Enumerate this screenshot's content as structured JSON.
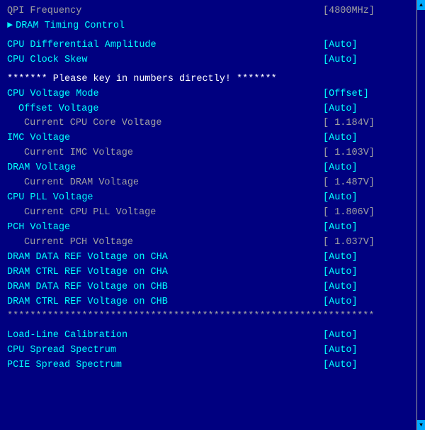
{
  "rows": [
    {
      "id": "qpi-freq",
      "label": "QPI Frequency",
      "value": "[4800MHz]",
      "labelClass": "gray",
      "valueClass": "gray",
      "indent": 0,
      "type": "normal"
    },
    {
      "id": "dram-timing",
      "label": "DRAM Timing Control",
      "value": "",
      "labelClass": "cyan",
      "valueClass": "",
      "indent": 0,
      "type": "arrow"
    },
    {
      "id": "spacer1",
      "label": "",
      "value": "",
      "type": "spacer"
    },
    {
      "id": "cpu-diff-amp",
      "label": "CPU Differential Amplitude",
      "value": "[Auto]",
      "labelClass": "cyan",
      "valueClass": "cyan",
      "indent": 0,
      "type": "normal"
    },
    {
      "id": "cpu-clk-skew",
      "label": "CPU Clock Skew",
      "value": "[Auto]",
      "labelClass": "cyan",
      "valueClass": "cyan",
      "indent": 0,
      "type": "normal"
    },
    {
      "id": "spacer2",
      "label": "",
      "value": "",
      "type": "spacer"
    },
    {
      "id": "warning",
      "label": "******* Please key in numbers directly! *******",
      "value": "",
      "labelClass": "white",
      "valueClass": "",
      "indent": 0,
      "type": "full"
    },
    {
      "id": "cpu-volt-mode",
      "label": "CPU Voltage Mode",
      "value": "[Offset]",
      "labelClass": "cyan",
      "valueClass": "cyan",
      "indent": 0,
      "type": "normal"
    },
    {
      "id": "offset-volt",
      "label": "Offset Voltage",
      "value": "[Auto]",
      "labelClass": "cyan",
      "valueClass": "cyan",
      "indent": 1,
      "type": "normal"
    },
    {
      "id": "curr-cpu-core",
      "label": "Current CPU Core Voltage",
      "value": "[ 1.184V]",
      "labelClass": "gray",
      "valueClass": "gray",
      "indent": 2,
      "type": "normal"
    },
    {
      "id": "imc-volt",
      "label": "IMC Voltage",
      "value": "[Auto]",
      "labelClass": "cyan",
      "valueClass": "cyan",
      "indent": 0,
      "type": "normal"
    },
    {
      "id": "curr-imc",
      "label": "Current IMC Voltage",
      "value": "[ 1.103V]",
      "labelClass": "gray",
      "valueClass": "gray",
      "indent": 2,
      "type": "normal"
    },
    {
      "id": "dram-volt",
      "label": "DRAM Voltage",
      "value": "[Auto]",
      "labelClass": "cyan",
      "valueClass": "cyan",
      "indent": 0,
      "type": "normal"
    },
    {
      "id": "curr-dram",
      "label": "Current DRAM Voltage",
      "value": "[ 1.487V]",
      "labelClass": "gray",
      "valueClass": "gray",
      "indent": 2,
      "type": "normal"
    },
    {
      "id": "cpu-pll-volt",
      "label": "CPU PLL Voltage",
      "value": "[Auto]",
      "labelClass": "cyan",
      "valueClass": "cyan",
      "indent": 0,
      "type": "normal"
    },
    {
      "id": "curr-cpu-pll",
      "label": "Current CPU PLL Voltage",
      "value": "[ 1.806V]",
      "labelClass": "gray",
      "valueClass": "gray",
      "indent": 2,
      "type": "normal"
    },
    {
      "id": "pch-volt",
      "label": "PCH Voltage",
      "value": "[Auto]",
      "labelClass": "cyan",
      "valueClass": "cyan",
      "indent": 0,
      "type": "normal"
    },
    {
      "id": "curr-pch",
      "label": "Current PCH Voltage",
      "value": "[ 1.037V]",
      "labelClass": "gray",
      "valueClass": "gray",
      "indent": 2,
      "type": "normal"
    },
    {
      "id": "dram-data-cha",
      "label": "DRAM DATA REF Voltage on CHA",
      "value": "[Auto]",
      "labelClass": "cyan",
      "valueClass": "cyan",
      "indent": 0,
      "type": "normal"
    },
    {
      "id": "dram-ctrl-cha",
      "label": "DRAM CTRL REF Voltage on CHA",
      "value": "[Auto]",
      "labelClass": "cyan",
      "valueClass": "cyan",
      "indent": 0,
      "type": "normal"
    },
    {
      "id": "dram-data-chb",
      "label": "DRAM DATA REF Voltage on CHB",
      "value": "[Auto]",
      "labelClass": "cyan",
      "valueClass": "cyan",
      "indent": 0,
      "type": "normal"
    },
    {
      "id": "dram-ctrl-chb",
      "label": "DRAM CTRL REF Voltage on CHB",
      "value": "[Auto]",
      "labelClass": "cyan",
      "valueClass": "cyan",
      "indent": 0,
      "type": "normal"
    },
    {
      "id": "separator",
      "label": "****************************************************************",
      "value": "",
      "labelClass": "gray",
      "valueClass": "",
      "indent": 0,
      "type": "full"
    },
    {
      "id": "spacer3",
      "label": "",
      "value": "",
      "type": "spacer"
    },
    {
      "id": "load-line",
      "label": "Load-Line Calibration",
      "value": "[Auto]",
      "labelClass": "cyan",
      "valueClass": "cyan",
      "indent": 0,
      "type": "normal"
    },
    {
      "id": "cpu-spread",
      "label": "CPU Spread Spectrum",
      "value": "[Auto]",
      "labelClass": "cyan",
      "valueClass": "cyan",
      "indent": 0,
      "type": "normal"
    },
    {
      "id": "pcie-spread",
      "label": "PCIE Spread Spectrum",
      "value": "[Auto]",
      "labelClass": "cyan",
      "valueClass": "cyan",
      "indent": 0,
      "type": "normal"
    }
  ],
  "scrollbar": {
    "up_arrow": "▲",
    "down_arrow": "▼"
  }
}
